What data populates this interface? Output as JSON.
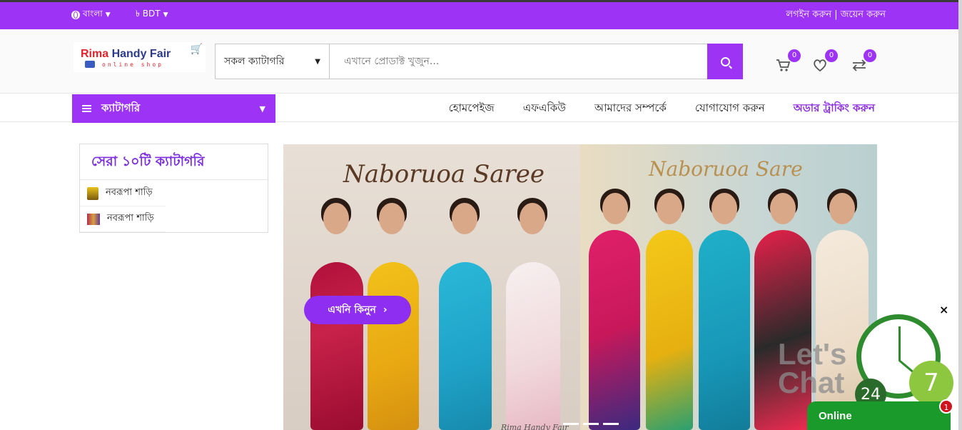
{
  "topbar": {
    "language": "বাংলা",
    "currency": "৳ BDT",
    "auth": "লগইন করুন | জয়েন করুন"
  },
  "logo": {
    "name_red": "Rima ",
    "name_blue": "Handy Fair",
    "tagline": "online shop"
  },
  "search": {
    "category": "সকল ক্যাটাগরি",
    "placeholder": "এখানে প্রোডাক্ট খুজুন..."
  },
  "header_icons": {
    "cart_count": "0",
    "wishlist_count": "0",
    "compare_count": "0"
  },
  "nav": {
    "category_button": "ক্যাটাগরি",
    "items": [
      "হোমপেইজ",
      "এফএকিউ",
      "আমাদের সম্পর্কে",
      "যোগাযোগ করুন",
      "অডার ট্রাকিং করুন"
    ]
  },
  "sidebar": {
    "title": "সেরা ১০টি ক্যাটাগরি",
    "items": [
      {
        "label": "নবরূপা শাড়ি"
      },
      {
        "label": "নবরূপা শাড়ি"
      }
    ]
  },
  "banner": {
    "left_title": "Naboruoa Saree",
    "right_title": "Naboruoa Sare",
    "buy_button": "এখনি কিনুন",
    "watermark": "Rima Handy Fair"
  },
  "chat": {
    "lets_chat": "Let's Chat",
    "num24": "24",
    "num7": "7",
    "online": "Online",
    "badge": "1",
    "close": "×"
  },
  "colors": {
    "brand": "#9d34f5",
    "online_green": "#1a9a2a"
  }
}
